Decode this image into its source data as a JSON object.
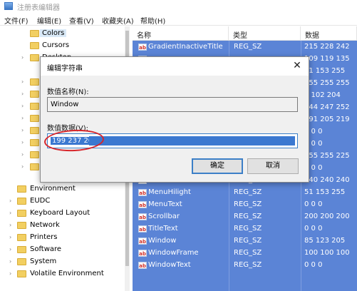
{
  "window": {
    "title": "注册表编辑器"
  },
  "menu": [
    "文件(F)",
    "编辑(E)",
    "查看(V)",
    "收藏夹(A)",
    "帮助(H)"
  ],
  "tree": {
    "items": [
      {
        "label": "Colors",
        "expandable": false,
        "selected": true
      },
      {
        "label": "Cursors",
        "expandable": false
      },
      {
        "label": "Desktop",
        "expandable": true
      },
      {
        "label": "Environment",
        "expandable": false
      },
      {
        "label": "EUDC",
        "expandable": true
      },
      {
        "label": "Keyboard Layout",
        "expandable": true
      },
      {
        "label": "Network",
        "expandable": true
      },
      {
        "label": "Printers",
        "expandable": true
      },
      {
        "label": "Software",
        "expandable": true
      },
      {
        "label": "System",
        "expandable": true
      },
      {
        "label": "Volatile Environment",
        "expandable": true
      }
    ]
  },
  "values": {
    "headers": {
      "name": "名称",
      "type": "类型",
      "data": "数据"
    },
    "rows": [
      {
        "name": "GradientInactiveTitle",
        "type": "REG_SZ",
        "data": "215 228 242"
      },
      {
        "name": "",
        "type": "",
        "data": "109 119 135"
      },
      {
        "name": "",
        "type": "",
        "data": "51 153 255"
      },
      {
        "name": "",
        "type": "",
        "data": "255 255 255"
      },
      {
        "name": "",
        "type": "",
        "data": "0 102 204"
      },
      {
        "name": "",
        "type": "",
        "data": "244 247 252"
      },
      {
        "name": "",
        "type": "",
        "data": "191 205 219"
      },
      {
        "name": "",
        "type": "",
        "data": "0 0 0"
      },
      {
        "name": "",
        "type": "",
        "data": "0 0 0"
      },
      {
        "name": "",
        "type": "",
        "data": "255 255 225"
      },
      {
        "name": "",
        "type": "",
        "data": "0 0 0"
      },
      {
        "name": "MenuBar",
        "type": "REG_SZ",
        "data": "240 240 240"
      },
      {
        "name": "MenuHilight",
        "type": "REG_SZ",
        "data": "51 153 255"
      },
      {
        "name": "MenuText",
        "type": "REG_SZ",
        "data": "0 0 0"
      },
      {
        "name": "Scrollbar",
        "type": "REG_SZ",
        "data": "200 200 200"
      },
      {
        "name": "TitleText",
        "type": "REG_SZ",
        "data": "0 0 0"
      },
      {
        "name": "Window",
        "type": "REG_SZ",
        "data": "85 123 205"
      },
      {
        "name": "WindowFrame",
        "type": "REG_SZ",
        "data": "100 100 100"
      },
      {
        "name": "WindowText",
        "type": "REG_SZ",
        "data": "0 0 0"
      }
    ]
  },
  "dialog": {
    "title": "编辑字符串",
    "name_label": "数值名称(N):",
    "name_value": "Window",
    "data_label": "数值数据(V):",
    "data_value": "199 237 204",
    "ok_label": "确定",
    "cancel_label": "取消",
    "close_glyph": "✕"
  },
  "colors": {
    "selection": "#5b84d6",
    "annotation_circle": "#d8262b"
  }
}
